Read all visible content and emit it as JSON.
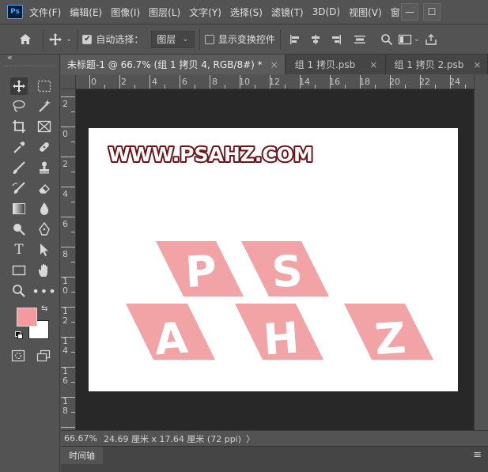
{
  "app": {
    "logo": "Ps"
  },
  "menu": [
    "文件(F)",
    "编辑(E)",
    "图像(I)",
    "图层(L)",
    "文字(Y)",
    "选择(S)",
    "滤镜(T)",
    "3D(D)",
    "视图(V)",
    "窗口"
  ],
  "window_controls": {
    "minimize": "—",
    "maximize": "☐"
  },
  "options": {
    "auto_select_label": "自动选择：",
    "auto_select_checked": "✔",
    "layer_select_value": "图层",
    "show_transform_label": "显示变换控件"
  },
  "tabs": [
    {
      "label": "未标题-1 @ 66.7% (组 1 拷贝 4, RGB/8#) *",
      "close": "×"
    },
    {
      "label": "组 1 拷贝.psb",
      "close": "×"
    },
    {
      "label": "组 1 拷贝 2.psb",
      "close": "×"
    }
  ],
  "ruler_h": [
    "0",
    "2",
    "4",
    "6",
    "8",
    "10",
    "12",
    "14",
    "16",
    "18",
    "20",
    "22",
    "24"
  ],
  "ruler_v": [
    "2",
    "0",
    "2",
    "4",
    "6",
    "8",
    "1",
    "0",
    "1",
    "2",
    "1",
    "4",
    "1",
    "6",
    "1",
    "8"
  ],
  "document": {
    "watermark": "WWW.PSAHZ.COM",
    "tiles": [
      "P",
      "S",
      "A",
      "H",
      "Z"
    ],
    "tile_color": "#f2a3a6"
  },
  "colors": {
    "foreground": "#f29a9e",
    "background": "#ffffff"
  },
  "status": {
    "zoom": "66.67%",
    "info": "24.69 厘米 x 17.64 厘米 (72 ppi)",
    "arrow": "〉"
  },
  "timeline": {
    "label": "时间轴"
  },
  "icons": {
    "collapse": "«",
    "menu": "≡"
  }
}
